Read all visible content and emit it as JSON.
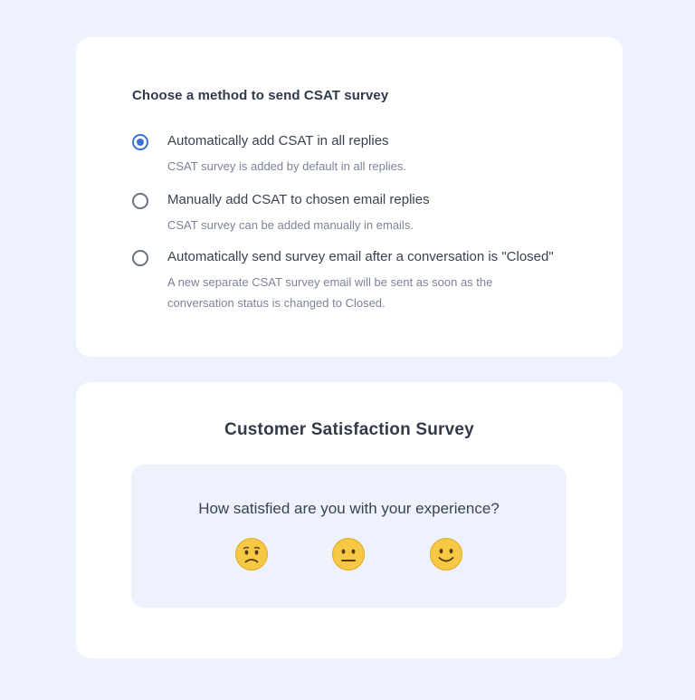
{
  "method_card": {
    "title": "Choose a method to send CSAT survey",
    "options": [
      {
        "label": "Automatically add CSAT in all replies",
        "description": "CSAT survey is added by default in all replies.",
        "selected": true
      },
      {
        "label": "Manually add CSAT to chosen email replies",
        "description": "CSAT survey can be added manually in emails.",
        "selected": false
      },
      {
        "label": "Automatically send survey email after a conversation is \"Closed\"",
        "description": "A new separate CSAT survey email will be sent as soon as the conversation status is changed to Closed.",
        "selected": false
      }
    ]
  },
  "survey_card": {
    "title": "Customer Satisfaction Survey",
    "question": "How satisfied are you with your experience?",
    "ratings": [
      "frowning-face-icon",
      "neutral-face-icon",
      "smiling-face-icon"
    ]
  },
  "colors": {
    "background": "#eef2fc",
    "accent": "#3b73d4",
    "emoji": "#f7c843"
  }
}
